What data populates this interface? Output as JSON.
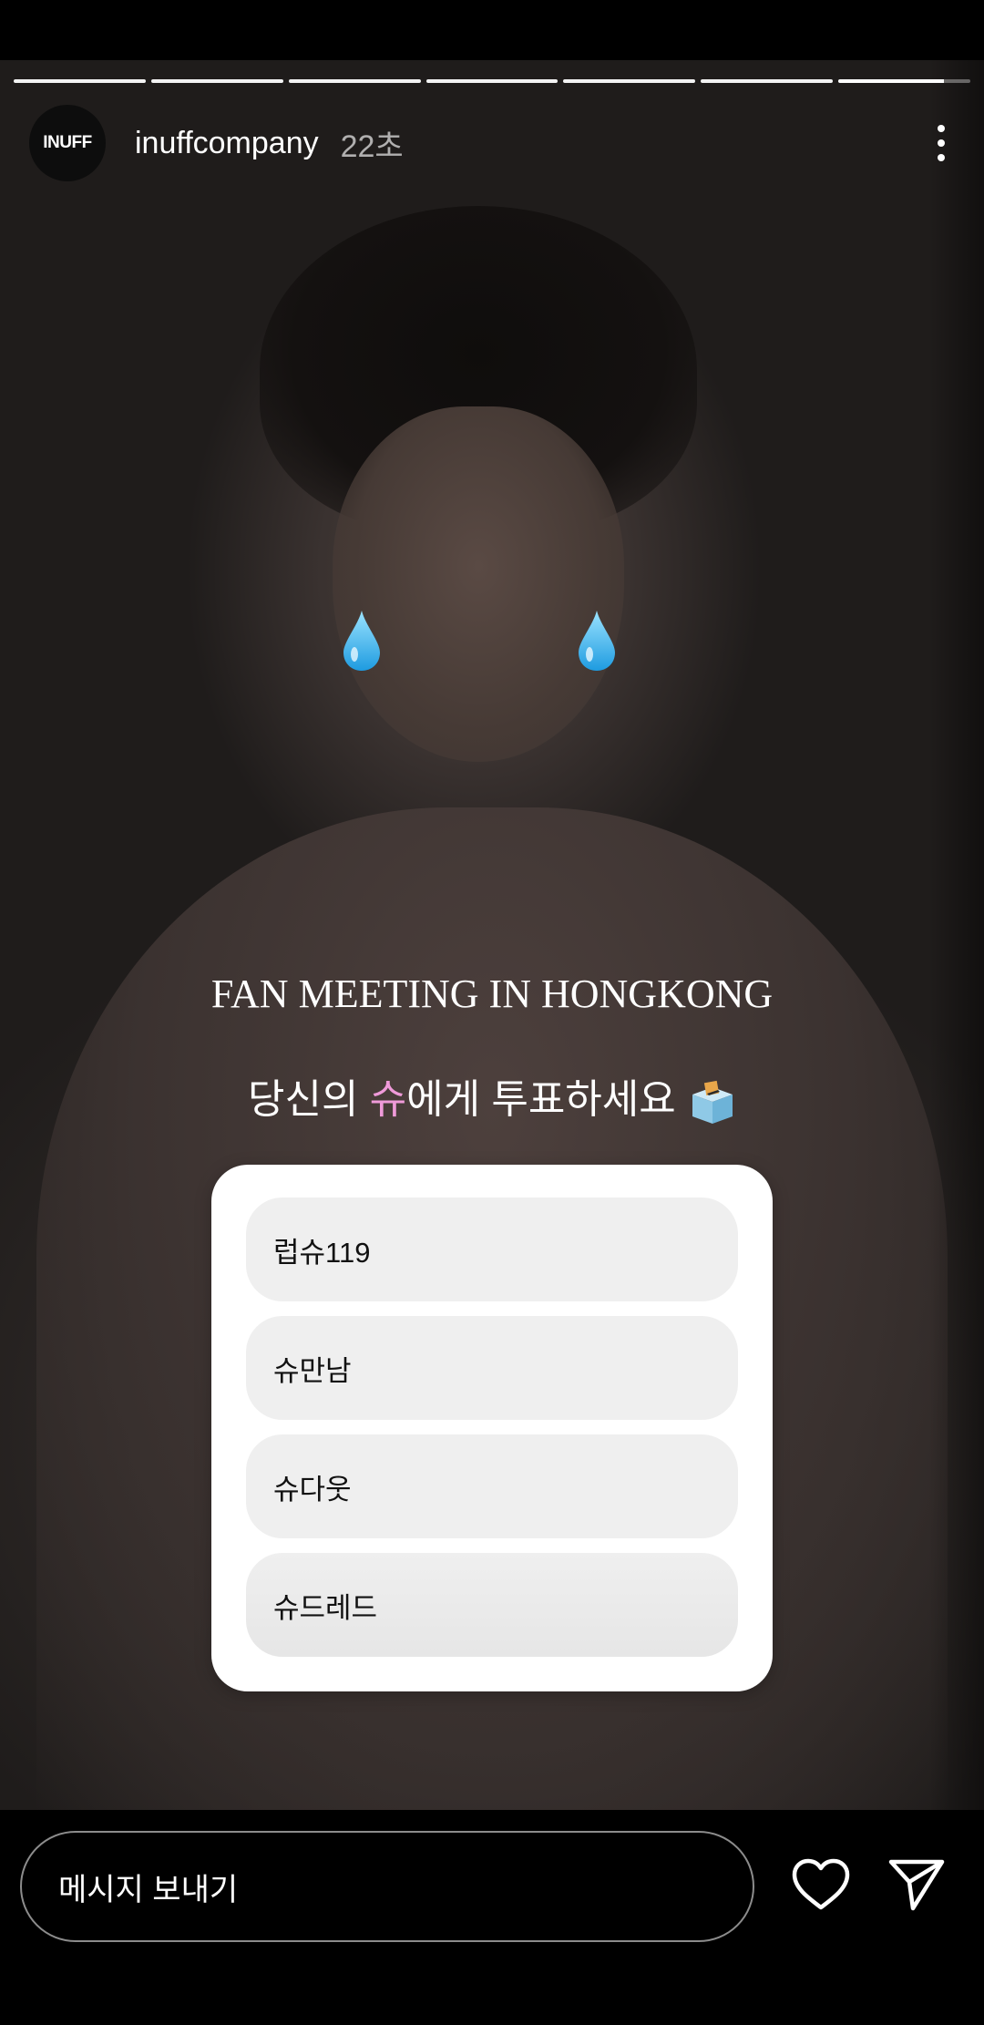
{
  "story": {
    "progress_segments": 7,
    "current_segment_fraction": 0.8
  },
  "header": {
    "avatar_text": "INUFF",
    "username": "inuffcompany",
    "time": "22초"
  },
  "content": {
    "title": "FAN MEETING IN HONGKONG",
    "subtitle_pre": "당신의 ",
    "subtitle_highlight": "슈",
    "subtitle_post": "에게 투표하세요",
    "highlight_color": "#ef9ad9",
    "stickers": [
      "water-drop-icon",
      "water-drop-icon",
      "ballot-box-icon"
    ]
  },
  "poll": {
    "options": [
      {
        "label": "럽슈119"
      },
      {
        "label": "슈만남"
      },
      {
        "label": "슈다웃"
      },
      {
        "label": "슈드레드"
      }
    ]
  },
  "bottom": {
    "message_placeholder": "메시지 보내기",
    "icons": [
      "heart-icon",
      "send-icon"
    ]
  }
}
